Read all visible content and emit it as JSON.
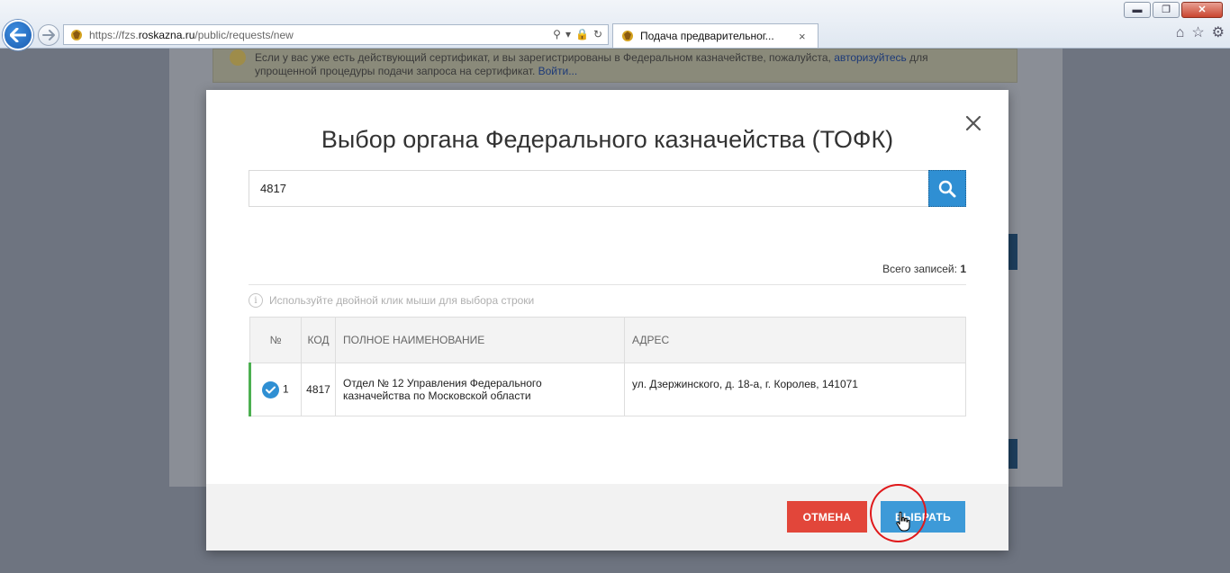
{
  "browser": {
    "url_prefix": "https://fzs.",
    "url_domain": "roskazna.ru",
    "url_path": "/public/requests/new",
    "tab_title": "Подача предварительног...",
    "tab_close": "×"
  },
  "background_page": {
    "notice_line1": "Если у вас уже есть действующий сертификат, и вы зарегистрированы в Федеральном казначействе, пожалуйста,",
    "notice_link1": "авторизуйтесь",
    "notice_line1_end": "для",
    "notice_line2": "упрощенной процедуры подачи запроса на сертификат.",
    "notice_link2": "Войти..."
  },
  "modal": {
    "title": "Выбор органа Федерального казначейства (ТОФК)",
    "search_value": "4817",
    "total_label": "Всего записей:",
    "total_count": "1",
    "hint": "Используйте двойной клик мыши для выбора строки",
    "columns": {
      "no": "№",
      "code": "КОД",
      "name": "ПОЛНОЕ НАИМЕНОВАНИЕ",
      "address": "АДРЕС"
    },
    "rows": [
      {
        "no": "1",
        "code": "4817",
        "name_line1": "Отдел № 12 Управления Федерального",
        "name_line2": "казначейства по Московской области",
        "address": "ул. Дзержинского, д. 18-а, г. Королев, 141071",
        "selected": true
      }
    ],
    "cancel_label": "ОТМЕНА",
    "select_label": "ВЫБРАТЬ"
  },
  "colors": {
    "primary": "#3d9ad8",
    "danger": "#e2463a",
    "selected_row_marker": "#4caf50"
  }
}
